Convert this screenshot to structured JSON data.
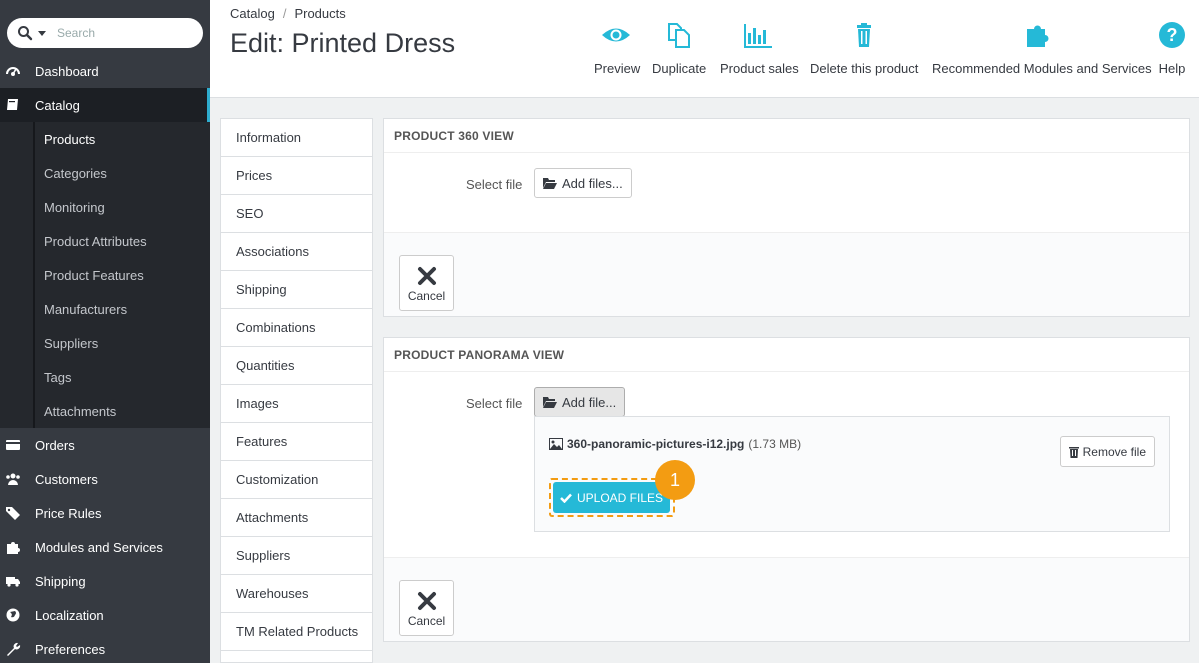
{
  "search": {
    "placeholder": "Search"
  },
  "sidebar": {
    "items": [
      {
        "label": "Dashboard",
        "icon": "dashboard-icon"
      },
      {
        "label": "Catalog",
        "icon": "book-icon",
        "active": true
      },
      {
        "label": "Orders",
        "icon": "credit-card-icon"
      },
      {
        "label": "Customers",
        "icon": "users-icon"
      },
      {
        "label": "Price Rules",
        "icon": "tag-icon"
      },
      {
        "label": "Modules and Services",
        "icon": "puzzle-icon"
      },
      {
        "label": "Shipping",
        "icon": "truck-icon"
      },
      {
        "label": "Localization",
        "icon": "globe-icon"
      },
      {
        "label": "Preferences",
        "icon": "wrench-icon"
      }
    ],
    "catalog_sub": [
      "Products",
      "Categories",
      "Monitoring",
      "Product Attributes",
      "Product Features",
      "Manufacturers",
      "Suppliers",
      "Tags",
      "Attachments"
    ]
  },
  "header": {
    "breadcrumb": [
      "Catalog",
      "Products"
    ],
    "title": "Edit: Printed Dress",
    "toolbar": [
      "Preview",
      "Duplicate",
      "Product sales",
      "Delete this product",
      "Recommended Modules and Services",
      "Help"
    ]
  },
  "tabs": [
    "Information",
    "Prices",
    "SEO",
    "Associations",
    "Shipping",
    "Combinations",
    "Quantities",
    "Images",
    "Features",
    "Customization",
    "Attachments",
    "Suppliers",
    "Warehouses",
    "TM Related Products"
  ],
  "panel360": {
    "title": "PRODUCT 360 VIEW",
    "select_label": "Select file",
    "add_button": "Add files...",
    "cancel": "Cancel"
  },
  "panorama": {
    "title": "PRODUCT PANORAMA VIEW",
    "select_label": "Select file",
    "add_button": "Add file...",
    "file_name": "360-panoramic-pictures-i12.jpg",
    "file_size": "(1.73 MB)",
    "remove_button": "Remove file",
    "upload_button": "UPLOAD FILES",
    "step_number": "1",
    "cancel": "Cancel"
  },
  "colors": {
    "sidebar": "#363a41",
    "accent": "#25b9d7",
    "highlight": "#f39c12"
  }
}
